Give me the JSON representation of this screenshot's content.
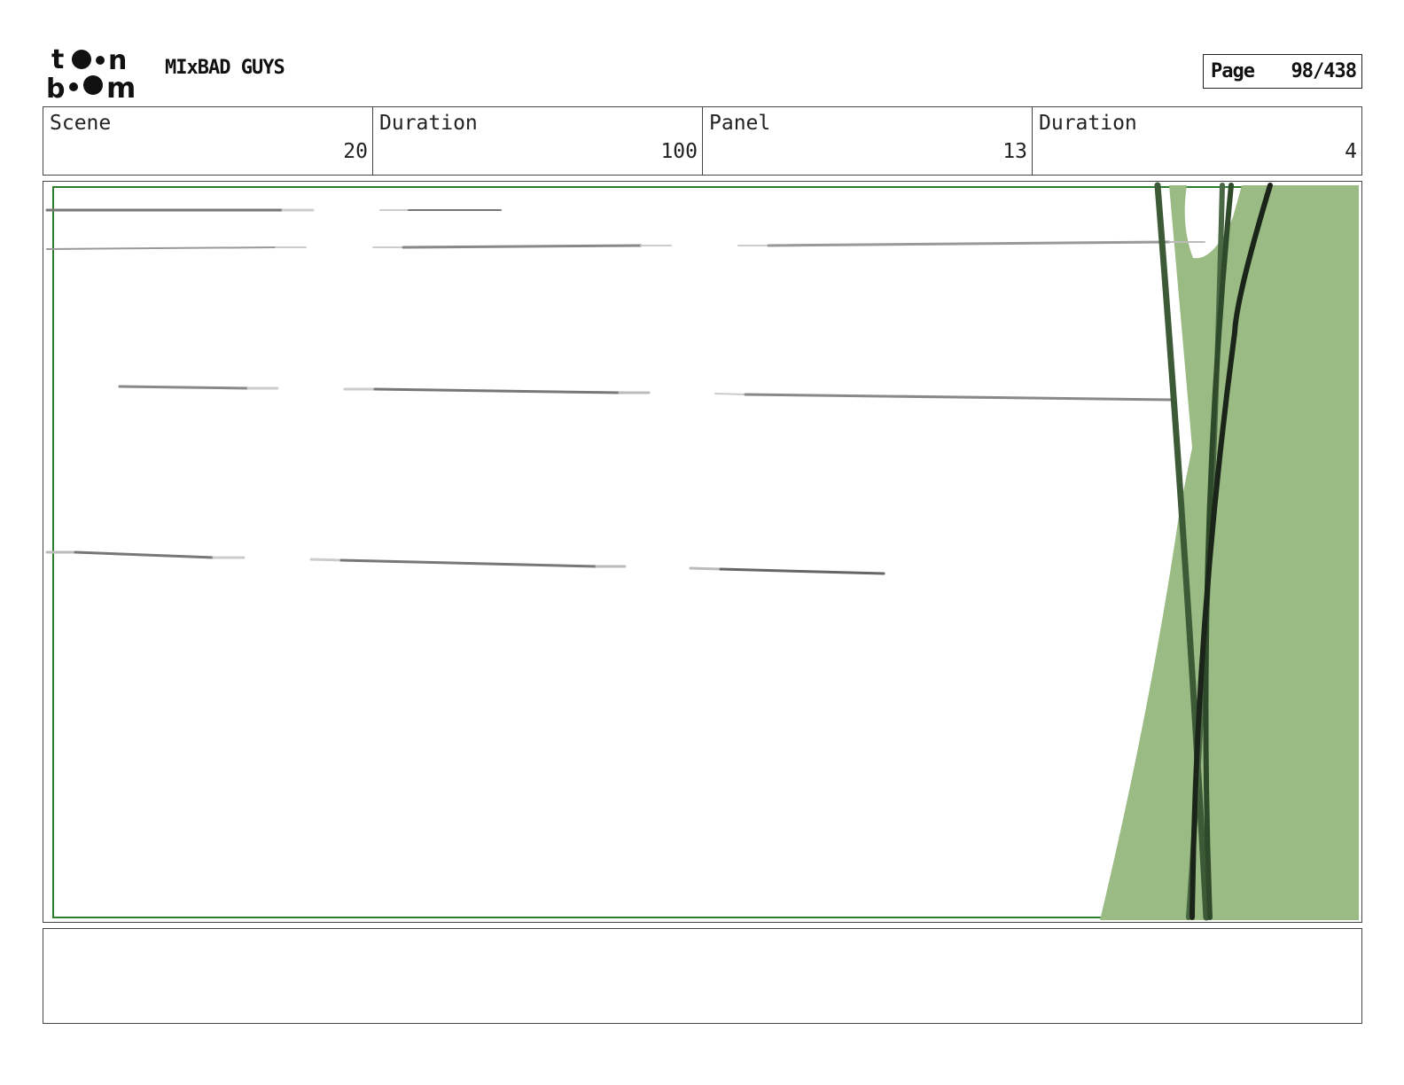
{
  "header": {
    "logo_text_line1": "toon",
    "logo_text_line2": "boom",
    "project_title": "MIxBAD GUYS",
    "page_label": "Page",
    "page_number": "98/438"
  },
  "info": {
    "scene_label": "Scene",
    "scene_value": "20",
    "scene_duration_label": "Duration",
    "scene_duration_value": "100",
    "panel_label": "Panel",
    "panel_value": "13",
    "panel_duration_label": "Duration",
    "panel_duration_value": "4"
  },
  "colors": {
    "frame_border": "#2e7d2e",
    "green_fill": "#9bbb85",
    "dark_stroke": "#2f4a2a"
  },
  "notes": {
    "text": ""
  }
}
